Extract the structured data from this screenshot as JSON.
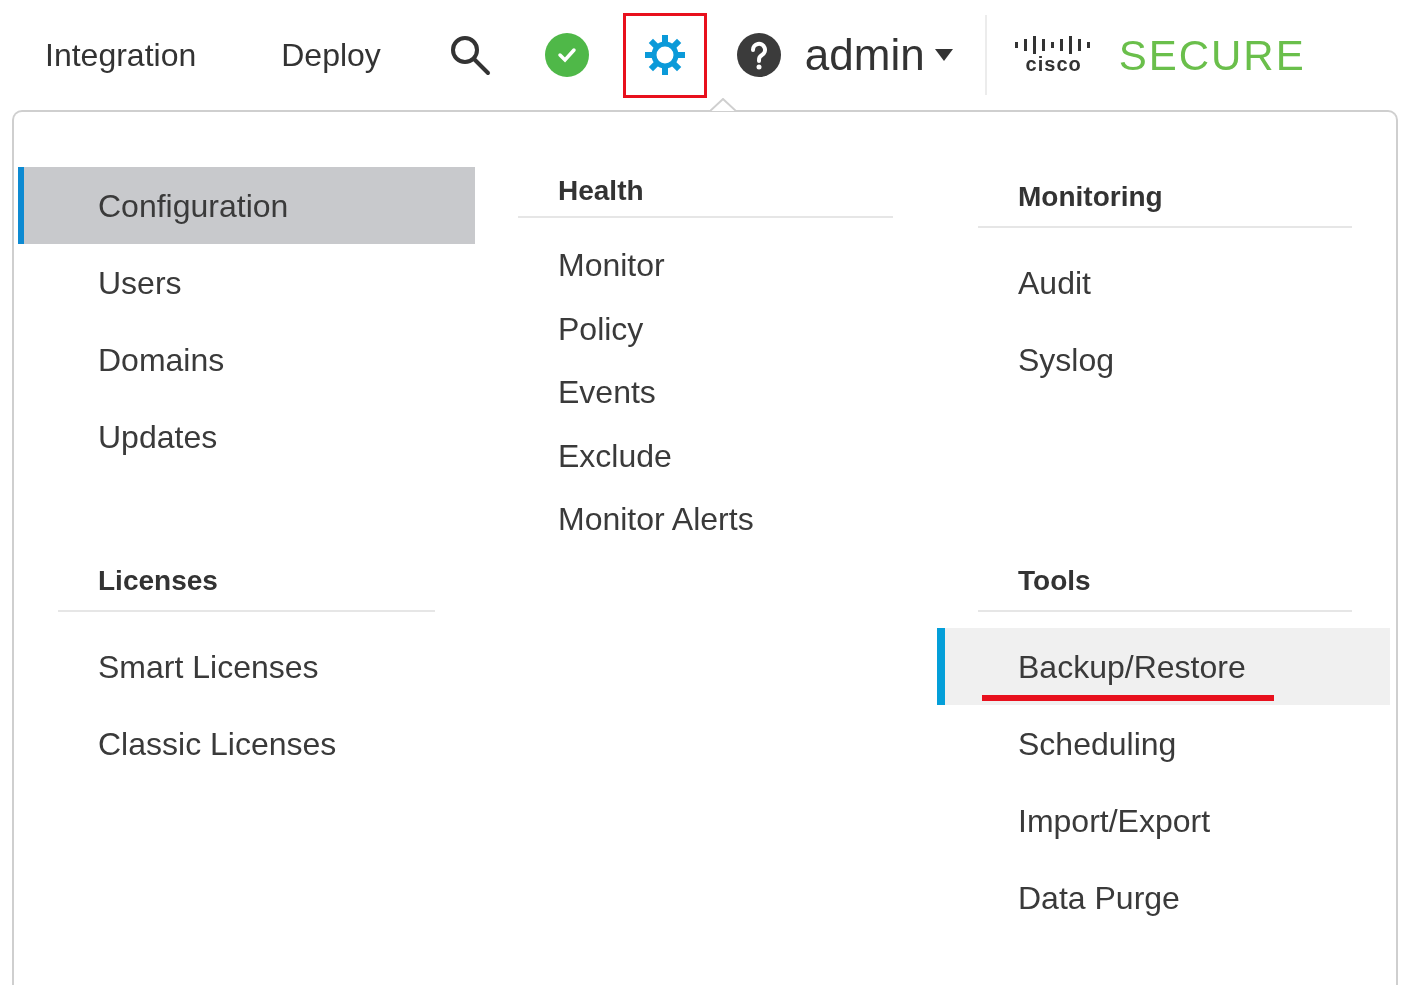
{
  "top_bar": {
    "nav": [
      {
        "label": "Integration"
      },
      {
        "label": "Deploy"
      }
    ],
    "settings": {
      "annotated": true
    },
    "user": {
      "label": "admin"
    },
    "logo": {
      "brand": "cisco",
      "product": "SECURE"
    }
  },
  "menu": {
    "columns": [
      {
        "sections": [
          {
            "items": [
              {
                "label": "Configuration",
                "selected": true,
                "hovered": false,
                "annotated": false
              },
              {
                "label": "Users",
                "selected": false,
                "hovered": false,
                "annotated": false
              },
              {
                "label": "Domains",
                "selected": false,
                "hovered": false,
                "annotated": false
              },
              {
                "label": "Updates",
                "selected": false,
                "hovered": false,
                "annotated": false
              }
            ]
          },
          {
            "heading": "Licenses",
            "items": [
              {
                "label": "Smart Licenses",
                "selected": false,
                "hovered": false,
                "annotated": false
              },
              {
                "label": "Classic Licenses",
                "selected": false,
                "hovered": false,
                "annotated": false
              }
            ]
          }
        ]
      },
      {
        "sections": [
          {
            "heading": "Health",
            "items": [
              {
                "label": "Monitor",
                "selected": false,
                "hovered": false,
                "annotated": false
              },
              {
                "label": "Policy",
                "selected": false,
                "hovered": false,
                "annotated": false
              },
              {
                "label": "Events",
                "selected": false,
                "hovered": false,
                "annotated": false
              },
              {
                "label": "Exclude",
                "selected": false,
                "hovered": false,
                "annotated": false
              },
              {
                "label": "Monitor Alerts",
                "selected": false,
                "hovered": false,
                "annotated": false
              }
            ]
          }
        ]
      },
      {
        "sections": [
          {
            "heading": "Monitoring",
            "items": [
              {
                "label": "Audit",
                "selected": false,
                "hovered": false,
                "annotated": false
              },
              {
                "label": "Syslog",
                "selected": false,
                "hovered": false,
                "annotated": false
              }
            ]
          },
          {
            "heading": "Tools",
            "items": [
              {
                "label": "Backup/Restore",
                "selected": false,
                "hovered": true,
                "annotated": true
              },
              {
                "label": "Scheduling",
                "selected": false,
                "hovered": false,
                "annotated": false
              },
              {
                "label": "Import/Export",
                "selected": false,
                "hovered": false,
                "annotated": false
              },
              {
                "label": "Data Purge",
                "selected": false,
                "hovered": false,
                "annotated": false
              }
            ]
          }
        ]
      }
    ]
  }
}
